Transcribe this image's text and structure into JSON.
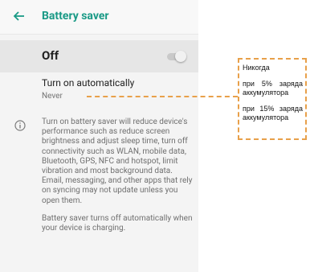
{
  "app_bar": {
    "title": "Battery saver",
    "back_icon": "arrow-back-icon"
  },
  "master_switch": {
    "label": "Off",
    "state": "off"
  },
  "auto_setting": {
    "title": "Turn on automatically",
    "summary": "Never"
  },
  "info": {
    "icon": "info-icon",
    "paragraphs": [
      "Turn on battery saver will reduce device's performance such as reduce screen brightness and adjust sleep time, turn off connectivity such as WLAN, mobile data, Bluetooth, GPS, NFC and hotspot, limit vibration and most background data. Email, messaging, and other apps that rely on syncing may not update unless you open them.",
      "Battery saver turns off automatically when your device is charging."
    ]
  },
  "callout": {
    "options": [
      "Никогда",
      "при 5% заряда аккумулятора",
      "при 15% заряда аккумулятора"
    ]
  },
  "colors": {
    "accent": "#1a9a86",
    "callout_border": "#e8a04a",
    "master_bg": "#e6e6e6"
  }
}
